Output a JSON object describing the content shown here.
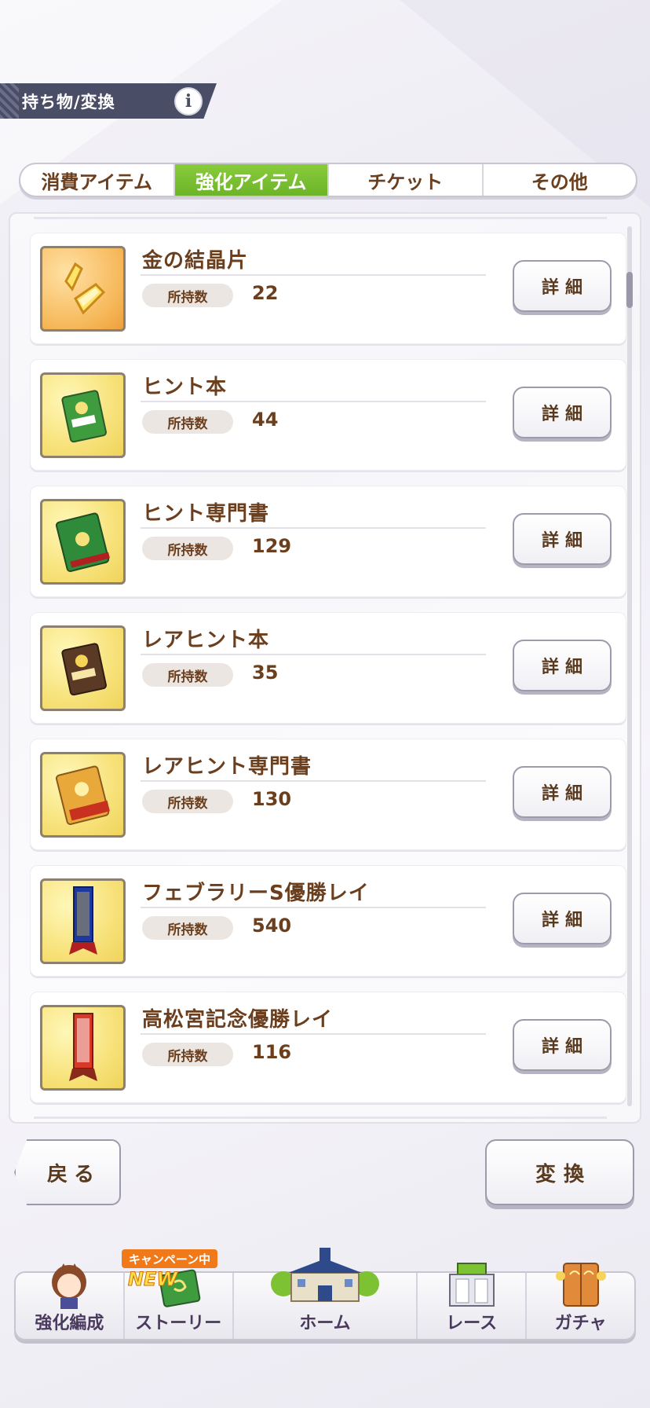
{
  "header": {
    "title": "持ち物/変換",
    "info_label": "i"
  },
  "tabs": [
    {
      "label": "消費アイテム",
      "active": false
    },
    {
      "label": "強化アイテム",
      "active": true
    },
    {
      "label": "チケット",
      "active": false
    },
    {
      "label": "その他",
      "active": false
    }
  ],
  "items": [
    {
      "name": "金の結晶片",
      "own_label": "所持数",
      "count": "22",
      "detail_label": "詳細",
      "icon": "gold-crystal-icon"
    },
    {
      "name": "ヒント本",
      "own_label": "所持数",
      "count": "44",
      "detail_label": "詳細",
      "icon": "hint-book-icon"
    },
    {
      "name": "ヒント専門書",
      "own_label": "所持数",
      "count": "129",
      "detail_label": "詳細",
      "icon": "hint-expert-book-icon"
    },
    {
      "name": "レアヒント本",
      "own_label": "所持数",
      "count": "35",
      "detail_label": "詳細",
      "icon": "rare-hint-book-icon"
    },
    {
      "name": "レアヒント専門書",
      "own_label": "所持数",
      "count": "130",
      "detail_label": "詳細",
      "icon": "rare-hint-expert-book-icon"
    },
    {
      "name": "フェブラリーS優勝レイ",
      "own_label": "所持数",
      "count": "540",
      "detail_label": "詳細",
      "icon": "february-stakes-lei-icon"
    },
    {
      "name": "高松宮記念優勝レイ",
      "own_label": "所持数",
      "count": "116",
      "detail_label": "詳細",
      "icon": "takamatsunomiya-lei-icon"
    }
  ],
  "buttons": {
    "back": "戻る",
    "convert": "変換"
  },
  "nav": {
    "campaign": "キャンペーン中",
    "new": "NEW",
    "items": [
      "強化編成",
      "ストーリー",
      "ホーム",
      "レース",
      "ガチャ"
    ]
  },
  "colors": {
    "active_tab": "#7cc232",
    "text_brown": "#6b3f1e",
    "header_bg": "#4a4d66"
  }
}
